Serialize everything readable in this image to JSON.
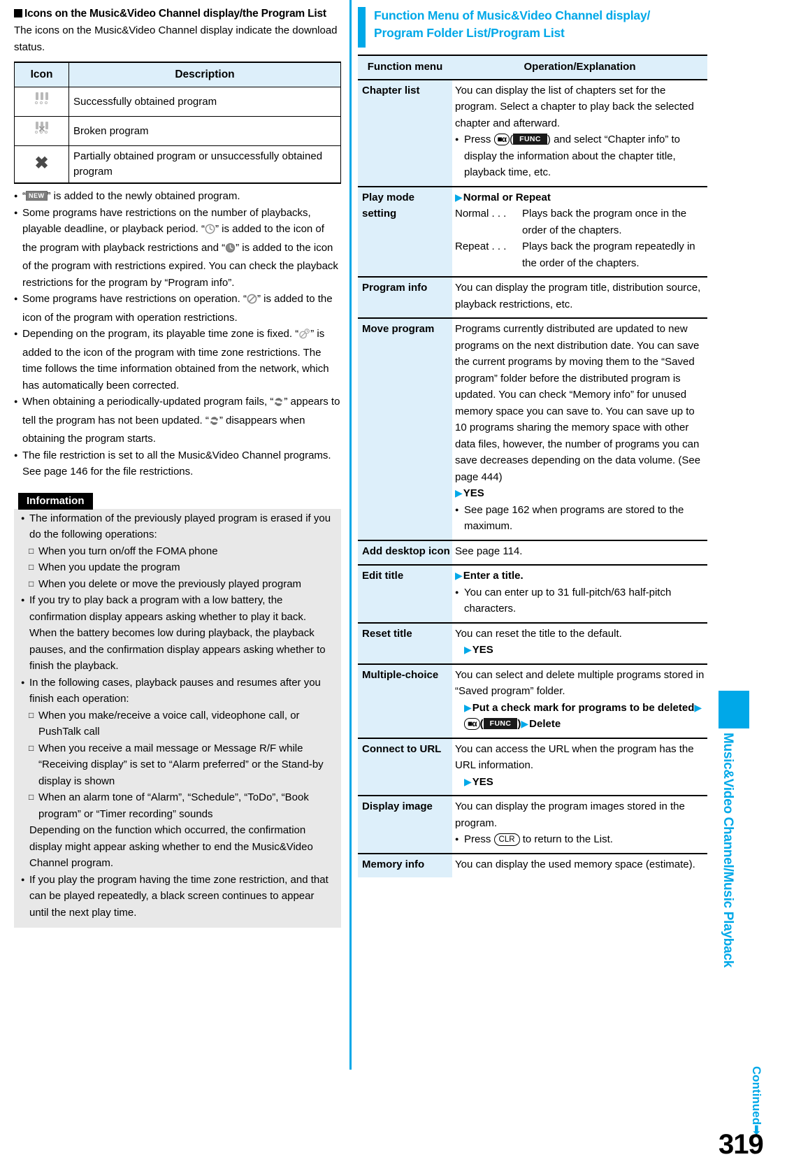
{
  "left": {
    "section_title": "Icons on the Music&Video Channel display/the Program List",
    "intro": "The icons on the Music&Video Channel display indicate the download status.",
    "icon_table": {
      "headers": [
        "Icon",
        "Description"
      ],
      "rows": [
        {
          "icon": "program-dots-icon",
          "desc": "Successfully obtained program"
        },
        {
          "icon": "program-dots-broken-icon",
          "desc": "Broken program"
        },
        {
          "icon": "big-x-icon",
          "desc": "Partially obtained program or unsuccessfully obtained program"
        }
      ]
    },
    "bullets": [
      "“NEW” is added to the newly obtained program.",
      "Some programs have restrictions on the number of playbacks, playable deadline, or playback period. “CLOCK” is added to the icon of the program with playback restrictions and “CLOCK-FILLED” is added to the icon of the program with restrictions expired. You can check the playback restrictions for the program by “Program info”.",
      "Some programs have restrictions on operation. “BAN” is added to the icon of the program with operation restrictions.",
      "Depending on the program, its playable time zone is fixed. “TIMEZONE” is added to the icon of the program with time zone restrictions. The time follows the time information obtained from the network, which has automatically been corrected.",
      "When obtaining a periodically-updated program fails, “REFRESH” appears to tell the program has not been updated. “REFRESH” disappears when obtaining the program starts.",
      "The file restriction is set to all the Music&Video Channel programs. See page 146 for the file restrictions."
    ],
    "information": {
      "tag": "Information",
      "items": [
        {
          "text": "The information of the previously played program is erased if you do the following operations:",
          "subs": [
            "When you turn on/off the FOMA phone",
            "When you update the program",
            "When you delete or move the previously played program"
          ]
        },
        {
          "text": "If you try to play back a program with a low battery, the confirmation display appears asking whether to play it back. When the battery becomes low during playback, the playback pauses, and the confirmation display appears asking whether to finish the playback.",
          "subs": []
        },
        {
          "text": "In the following cases, playback pauses and resumes after you finish each operation:",
          "subs": [
            "When you make/receive a voice call, videophone call, or PushTalk call",
            "When you receive a mail message or Message R/F while “Receiving display” is set to “Alarm preferred” or the Stand-by display is shown",
            "When an alarm tone of “Alarm”, “Schedule”, “ToDo”, “Book program” or “Timer recording” sounds"
          ],
          "tail": "Depending on the function which occurred, the confirmation display might appear asking whether to end the Music&Video Channel program."
        },
        {
          "text": "If you play the program having the time zone restriction, and that can be played repeatedly, a black screen continues to appear until the next play time.",
          "subs": []
        }
      ]
    }
  },
  "right": {
    "heading_line1": "Function Menu of Music&Video Channel display/",
    "heading_line2": "Program Folder List/Program List",
    "table_headers": [
      "Function menu",
      "Operation/Explanation"
    ],
    "rows": [
      {
        "menu": "Chapter list",
        "body_lines": [
          "You can display the list of chapters set for the program. Select a chapter to play back the selected chapter and afterward."
        ],
        "note": "Press IMODE(FUNC) and select “Chapter info” to display the information about the chapter title, playback time, etc."
      },
      {
        "menu": "Play mode setting",
        "arrow_bold": "Normal or Repeat",
        "defs": [
          {
            "term": "Normal . . .",
            "desc": "Plays back the program once in the order of the chapters."
          },
          {
            "term": "Repeat . . .",
            "desc": "Plays back the program repeatedly in the order of the chapters."
          }
        ]
      },
      {
        "menu": "Program info",
        "body_lines": [
          "You can display the program title, distribution source, playback restrictions, etc."
        ]
      },
      {
        "menu": "Move program",
        "body_lines": [
          "Programs currently distributed are updated to new programs on the next distribution date. You can save the current programs by moving them to the “Saved program” folder before the distributed program is updated. You can check “Memory info” for unused memory space you can save to. You can save up to 10 programs sharing the memory space with other data files, however, the number of programs you can save decreases depending on the data volume. (See page 444)"
        ],
        "arrow_bold": "YES",
        "note": "See page 162 when programs are stored to the maximum."
      },
      {
        "menu": "Add desktop icon",
        "body_lines": [
          "See page 114."
        ]
      },
      {
        "menu": "Edit title",
        "arrow_bold": "Enter a title.",
        "note": "You can enter up to 31 full-pitch/63 half-pitch characters."
      },
      {
        "menu": "Reset title",
        "body_lines": [
          "You can reset the title to the default."
        ],
        "arrow_bold_indent": "YES"
      },
      {
        "menu": "Multiple-choice",
        "body_lines": [
          "You can select and delete multiple programs stored in “Saved program” folder."
        ],
        "steps": {
          "step1": "Put a check mark for programs to be deleted",
          "key_label": "FUNC",
          "step2": "Delete"
        }
      },
      {
        "menu": "Connect to URL",
        "body_lines": [
          "You can access the URL when the program has the URL information."
        ],
        "arrow_bold_indent": "YES"
      },
      {
        "menu": "Display image",
        "body_lines": [
          "You can display the program images stored in the program."
        ],
        "note_clr": {
          "pre": "Press",
          "key": "CLR",
          "post": "to return to the List."
        }
      },
      {
        "menu": "Memory info",
        "body_lines": [
          "You can display the used memory space (estimate)."
        ]
      }
    ]
  },
  "side": {
    "vertical_title": "Music&Video Channel/Music Playback",
    "continued": "Continued",
    "page_number": "319"
  },
  "colors": {
    "accent": "#00a8e8",
    "table_header_bg": "#ddeffa",
    "info_bg": "#e8e8e8"
  }
}
